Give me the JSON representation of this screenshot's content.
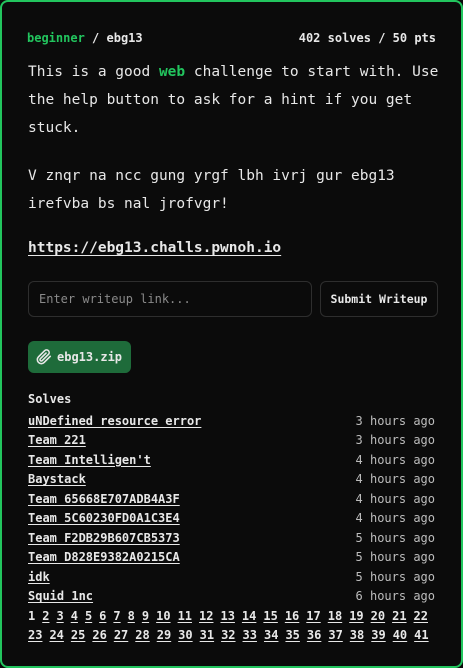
{
  "challenge": {
    "category": "beginner",
    "separator": "/",
    "name": "ebg13",
    "solves_label": "402 solves / 50 pts",
    "desc_line1_pre": "This is a good ",
    "desc_line1_hl": "web",
    "desc_line1_post": " challenge to start with. Use the help button to ask for a hint if you get stuck.",
    "desc_line2": "V znqr na ncc gung yrgf lbh ivrj gur ebg13 irefvba bs nal jrofvgr!",
    "url": "https://ebg13.challs.pwnoh.io"
  },
  "writeup": {
    "placeholder": "Enter writeup link...",
    "value": "",
    "submit_label": "Submit Writeup"
  },
  "attachment": {
    "icon": "paperclip-icon",
    "label": "ebg13.zip"
  },
  "solves": {
    "title": "Solves",
    "items": [
      {
        "team": "uNDefined resource error",
        "time": "3 hours ago"
      },
      {
        "team": "Team 221",
        "time": "3 hours ago"
      },
      {
        "team": "Team Intelligen't",
        "time": "4 hours ago"
      },
      {
        "team": "Baystack",
        "time": "4 hours ago"
      },
      {
        "team": "Team 65668E707ADB4A3F",
        "time": "4 hours ago"
      },
      {
        "team": "Team 5C60230FD0A1C3E4",
        "time": "4 hours ago"
      },
      {
        "team": "Team F2DB29B607CB5373",
        "time": "5 hours ago"
      },
      {
        "team": "Team D828E9382A0215CA",
        "time": "5 hours ago"
      },
      {
        "team": "idk",
        "time": "5 hours ago"
      },
      {
        "team": "Squid 1nc",
        "time": "6 hours ago"
      }
    ]
  },
  "pagination": {
    "current": "1",
    "pages": [
      "1",
      "2",
      "3",
      "4",
      "5",
      "6",
      "7",
      "8",
      "9",
      "10",
      "11",
      "12",
      "13",
      "14",
      "15",
      "16",
      "17",
      "18",
      "19",
      "20",
      "21",
      "22",
      "23",
      "24",
      "25",
      "26",
      "27",
      "28",
      "29",
      "30",
      "31",
      "32",
      "33",
      "34",
      "35",
      "36",
      "37",
      "38",
      "39",
      "40",
      "41"
    ]
  },
  "colors": {
    "accent": "#22c55e",
    "file_button": "#1e6b3a",
    "background": "#0b0b0b"
  }
}
